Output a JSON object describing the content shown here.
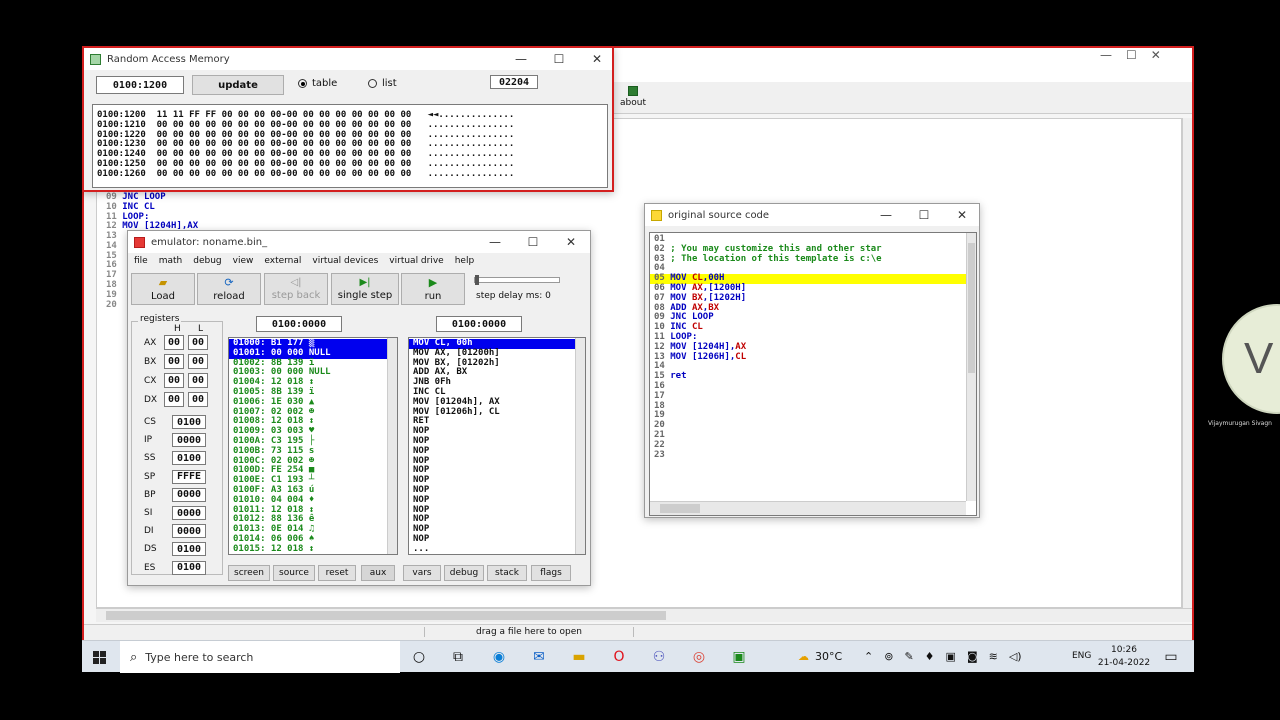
{
  "ram": {
    "title": "Random Access Memory",
    "address": "0100:1200",
    "update_label": "update",
    "table_label": "table",
    "list_label": "list",
    "value_box": "02204",
    "rows": [
      {
        "addr": "0100:1200",
        "bytes": "11 11 FF FF 00 00 00 00-00 00 00 00 00 00 00 00",
        "ascii": "◄◄.............."
      },
      {
        "addr": "0100:1210",
        "bytes": "00 00 00 00 00 00 00 00-00 00 00 00 00 00 00 00",
        "ascii": "................"
      },
      {
        "addr": "0100:1220",
        "bytes": "00 00 00 00 00 00 00 00-00 00 00 00 00 00 00 00",
        "ascii": "................"
      },
      {
        "addr": "0100:1230",
        "bytes": "00 00 00 00 00 00 00 00-00 00 00 00 00 00 00 00",
        "ascii": "................"
      },
      {
        "addr": "0100:1240",
        "bytes": "00 00 00 00 00 00 00 00-00 00 00 00 00 00 00 00",
        "ascii": "................"
      },
      {
        "addr": "0100:1250",
        "bytes": "00 00 00 00 00 00 00 00-00 00 00 00 00 00 00 00",
        "ascii": "................"
      },
      {
        "addr": "0100:1260",
        "bytes": "00 00 00 00 00 00 00 00-00 00 00 00 00 00 00 00",
        "ascii": "................"
      }
    ]
  },
  "editor": {
    "about_label": "about",
    "lines": [
      {
        "n": "09",
        "code": "JNC LOOP"
      },
      {
        "n": "10",
        "code": "INC CL"
      },
      {
        "n": "11",
        "code": "LOOP:"
      },
      {
        "n": "12",
        "code": "MOV [1204H],AX"
      }
    ],
    "extra_numbers": [
      "13",
      "14",
      "15",
      "16",
      "17",
      "18",
      "19",
      "20"
    ],
    "status": "drag a file here to open"
  },
  "emulator": {
    "title": "emulator: noname.bin_",
    "menu": [
      "file",
      "math",
      "debug",
      "view",
      "external",
      "virtual devices",
      "virtual drive",
      "help"
    ],
    "toolbar": [
      "Load",
      "reload",
      "step back",
      "single step",
      "run"
    ],
    "step_delay": "step delay ms: 0",
    "registers_label": "registers",
    "h_label": "H",
    "l_label": "L",
    "regs_hl": [
      {
        "name": "AX",
        "h": "00",
        "l": "00"
      },
      {
        "name": "BX",
        "h": "00",
        "l": "00"
      },
      {
        "name": "CX",
        "h": "00",
        "l": "00"
      },
      {
        "name": "DX",
        "h": "00",
        "l": "00"
      }
    ],
    "regs": [
      {
        "name": "CS",
        "v": "0100"
      },
      {
        "name": "IP",
        "v": "0000"
      },
      {
        "name": "SS",
        "v": "0100"
      },
      {
        "name": "SP",
        "v": "FFFE"
      },
      {
        "name": "BP",
        "v": "0000"
      },
      {
        "name": "SI",
        "v": "0000"
      },
      {
        "name": "DI",
        "v": "0000"
      },
      {
        "name": "DS",
        "v": "0100"
      },
      {
        "name": "ES",
        "v": "0100"
      }
    ],
    "mem_address": "0100:0000",
    "dis_address": "0100:0000",
    "mem_rows": [
      "01000: B1 177 ▒",
      "01001: 00 000 NULL",
      "01002: 8B 139 ï",
      "01003: 00 000 NULL",
      "01004: 12 018 ↕",
      "01005: 8B 139 ï",
      "01006: 1E 030 ▲",
      "01007: 02 002 ☻",
      "01008: 12 018 ↕",
      "01009: 03 003 ♥",
      "0100A: C3 195 ├",
      "0100B: 73 115 s",
      "0100C: 02 002 ☻",
      "0100D: FE 254 ■",
      "0100E: C1 193 ┴",
      "0100F: A3 163 ú",
      "01010: 04 004 ♦",
      "01011: 12 018 ↕",
      "01012: 88 136 ê",
      "01013: 0E 014 ♫",
      "01014: 06 006 ♠",
      "01015: 12 018 ↕"
    ],
    "dis_rows": [
      "MOV CL, 00h",
      "MOV AX, [01200h]",
      "MOV BX, [01202h]",
      "ADD AX, BX",
      "JNB 0Fh",
      "INC CL",
      "MOV [01204h], AX",
      "MOV [01206h], CL",
      "RET",
      "NOP",
      "NOP",
      "NOP",
      "NOP",
      "NOP",
      "NOP",
      "NOP",
      "NOP",
      "NOP",
      "NOP",
      "NOP",
      "NOP",
      "..."
    ],
    "bottom_buttons": [
      "screen",
      "source",
      "reset",
      "aux",
      "vars",
      "debug",
      "stack",
      "flags"
    ]
  },
  "source": {
    "title": "original source code",
    "lines": [
      {
        "n": "01",
        "parts": []
      },
      {
        "n": "02",
        "parts": [
          {
            "t": "; You may customize this and other star",
            "c": "green"
          }
        ]
      },
      {
        "n": "03",
        "parts": [
          {
            "t": "; The location of this template is c:\\e",
            "c": "green"
          }
        ]
      },
      {
        "n": "04",
        "parts": []
      },
      {
        "n": "05",
        "parts": [
          {
            "t": "MOV ",
            "c": "kw"
          },
          {
            "t": "CL",
            "c": "reg"
          },
          {
            "t": ",00H",
            "c": "kw"
          }
        ],
        "hl": true
      },
      {
        "n": "06",
        "parts": [
          {
            "t": "MOV ",
            "c": "kw"
          },
          {
            "t": "AX",
            "c": "reg"
          },
          {
            "t": ",[1200H]",
            "c": "kw"
          }
        ]
      },
      {
        "n": "07",
        "parts": [
          {
            "t": "MOV ",
            "c": "kw"
          },
          {
            "t": "BX",
            "c": "reg"
          },
          {
            "t": ",[1202H]",
            "c": "kw"
          }
        ]
      },
      {
        "n": "08",
        "parts": [
          {
            "t": "ADD ",
            "c": "kw"
          },
          {
            "t": "AX",
            "c": "reg"
          },
          {
            "t": ",",
            "c": "kw"
          },
          {
            "t": "BX",
            "c": "reg"
          }
        ]
      },
      {
        "n": "09",
        "parts": [
          {
            "t": "JNC LOOP",
            "c": "kw"
          }
        ]
      },
      {
        "n": "10",
        "parts": [
          {
            "t": "INC ",
            "c": "kw"
          },
          {
            "t": "CL",
            "c": "reg"
          }
        ]
      },
      {
        "n": "11",
        "parts": [
          {
            "t": "LOOP:",
            "c": "kw"
          }
        ]
      },
      {
        "n": "12",
        "parts": [
          {
            "t": "MOV [1204H],",
            "c": "kw"
          },
          {
            "t": "AX",
            "c": "reg"
          }
        ]
      },
      {
        "n": "13",
        "parts": [
          {
            "t": "MOV [1206H],",
            "c": "kw"
          },
          {
            "t": "CL",
            "c": "reg"
          }
        ]
      },
      {
        "n": "14",
        "parts": []
      },
      {
        "n": "15",
        "parts": [
          {
            "t": "ret",
            "c": "kw"
          }
        ]
      },
      {
        "n": "16",
        "parts": []
      },
      {
        "n": "17",
        "parts": []
      },
      {
        "n": "18",
        "parts": []
      },
      {
        "n": "19",
        "parts": []
      },
      {
        "n": "20",
        "parts": []
      },
      {
        "n": "21",
        "parts": []
      },
      {
        "n": "22",
        "parts": []
      },
      {
        "n": "23",
        "parts": []
      }
    ]
  },
  "taskbar": {
    "search_placeholder": "Type here to search",
    "weather": "30°C",
    "language": "ENG",
    "time": "10:26",
    "date": "21-04-2022"
  },
  "participant": {
    "initial": "V",
    "name": "Vijaymurugan Sivagn"
  },
  "colors": {
    "accent_red": "#d31f1f",
    "selection_blue": "#0000ee",
    "highlight_yellow": "#ffff00",
    "code_green": "#1b8a1b"
  }
}
